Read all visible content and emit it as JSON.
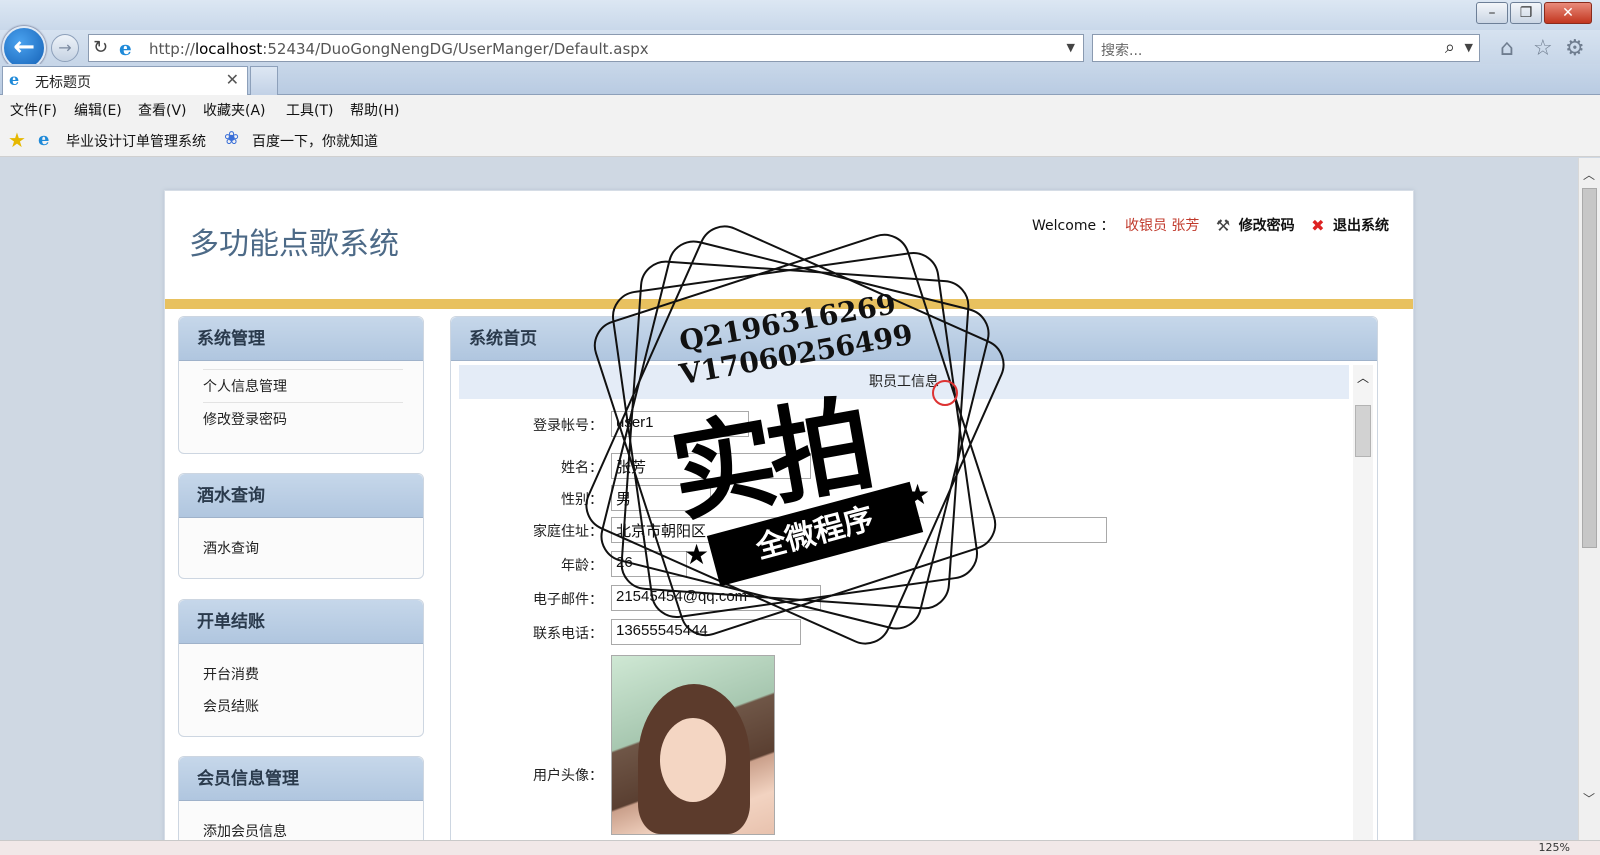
{
  "browser": {
    "url_prefix": "http://",
    "url_host": "localhost",
    "url_rest": ":52434/DuoGongNengDG/UserManger/Default.aspx",
    "search_placeholder": "搜索...",
    "tab_title": "无标题页",
    "menu": [
      "文件(F)",
      "编辑(E)",
      "查看(V)",
      "收藏夹(A)",
      "工具(T)",
      "帮助(H)"
    ],
    "favorites": [
      "毕业设计订单管理系统",
      "百度一下，你就知道"
    ],
    "zoom": "125%"
  },
  "header": {
    "site_title": "多功能点歌系统",
    "welcome": "Welcome ：",
    "user": "收银员 张芳",
    "change_password": "修改密码",
    "logout": "退出系统"
  },
  "sidebar": [
    {
      "title": "系统管理",
      "items": [
        "个人信息管理",
        "修改登录密码"
      ]
    },
    {
      "title": "酒水查询",
      "items": [
        "酒水查询"
      ]
    },
    {
      "title": "开单结账",
      "items": [
        "开台消费",
        "会员结账"
      ]
    },
    {
      "title": "会员信息管理",
      "items": [
        "添加会员信息"
      ]
    }
  ],
  "main": {
    "title": "系统首页",
    "section_title": "职员工信息",
    "fields": {
      "login_label": "登录帐号：",
      "login_value": "user1",
      "name_label": "姓名：",
      "name_value": "张芳",
      "gender_label": "性别：",
      "gender_value": "男",
      "address_label": "家庭住址：",
      "address_value": "北京市朝阳区",
      "age_label": "年龄：",
      "age_value": "26",
      "email_label": "电子邮件：",
      "email_value": "21545454@qq.com",
      "phone_label": "联系电话：",
      "phone_value": "13655545444",
      "avatar_label": "用户头像："
    }
  },
  "stamp": {
    "line1": "Q2196316269",
    "line2": "V17060256499",
    "big": "实拍",
    "ribbon": "全微程序"
  }
}
